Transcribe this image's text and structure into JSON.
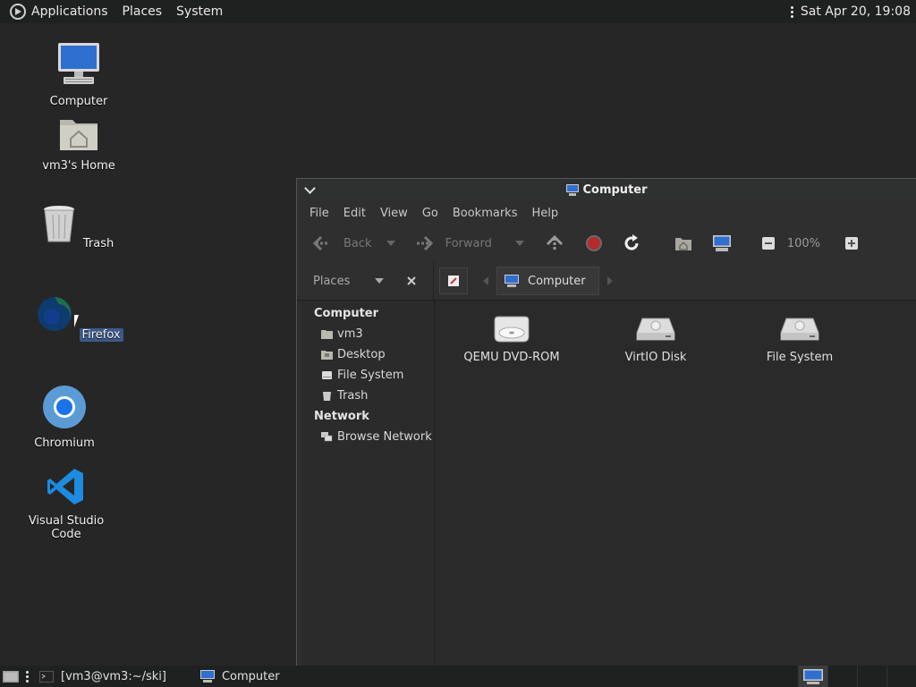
{
  "topbar": {
    "menus": [
      "Applications",
      "Places",
      "System"
    ],
    "clock": "Sat Apr 20, 19:08"
  },
  "desktop": {
    "icons": [
      {
        "label": "Computer",
        "icon": "computer-icon"
      },
      {
        "label": "vm3's Home",
        "icon": "home-folder-icon"
      },
      {
        "label": "Trash",
        "icon": "trash-icon"
      },
      {
        "label": "Firefox",
        "icon": "firefox-icon",
        "selected": true
      },
      {
        "label": "Chromium",
        "icon": "chromium-icon"
      },
      {
        "label": "Visual Studio Code",
        "icon": "vscode-icon"
      }
    ]
  },
  "window": {
    "title": "Computer",
    "menu": [
      "File",
      "Edit",
      "View",
      "Go",
      "Bookmarks",
      "Help"
    ],
    "toolbar": {
      "back_label": "Back",
      "forward_label": "Forward",
      "zoom": "100%"
    },
    "location": {
      "places_label": "Places",
      "crumb": "Computer"
    },
    "sidebar": {
      "computer_heading": "Computer",
      "computer_items": [
        "vm3",
        "Desktop",
        "File System",
        "Trash"
      ],
      "network_heading": "Network",
      "network_items": [
        "Browse Network"
      ]
    },
    "drives": [
      "QEMU DVD-ROM",
      "VirtIO Disk",
      "File System"
    ]
  },
  "taskbar": {
    "tasks": [
      "[vm3@vm3:~/ski]",
      "Computer"
    ]
  },
  "colors": {
    "desktop_bg": "#262626",
    "panel_bg": "#1f2120",
    "selection": "#3b5a8a"
  }
}
